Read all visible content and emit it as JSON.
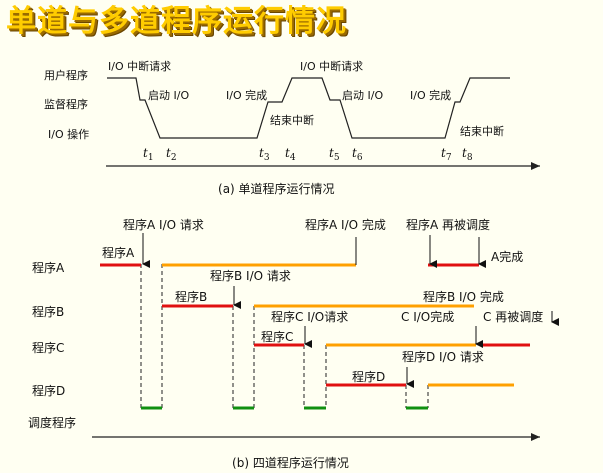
{
  "title": "单道与多道程序运行情况",
  "single": {
    "rows": [
      "用户程序",
      "监督程序",
      "I/O  操作"
    ],
    "labels": {
      "io_interrupt_1": "I/O  中断请求",
      "start_io_1": "启动  I/O",
      "io_done_1": "I/O  完成",
      "end_int_1": "结束中断",
      "io_interrupt_2": "I/O  中断请求",
      "start_io_2": "启动  I/O",
      "io_done_2": "I/O  完成",
      "end_int_2": "结束中断"
    },
    "t_labels": [
      {
        "t": "t",
        "sub": "1"
      },
      {
        "t": "t",
        "sub": "2"
      },
      {
        "t": "t",
        "sub": "3"
      },
      {
        "t": "t",
        "sub": "4"
      },
      {
        "t": "t",
        "sub": "5"
      },
      {
        "t": "t",
        "sub": "6"
      },
      {
        "t": "t",
        "sub": "7"
      },
      {
        "t": "t",
        "sub": "8"
      }
    ],
    "caption": {
      "letter": "a",
      "text": "单道程序运行情况"
    }
  },
  "multi": {
    "rows": [
      "程序A",
      "程序B",
      "程序C",
      "程序D",
      "调度程序"
    ],
    "labels": {
      "a_io_request": "程序A I/O 请求",
      "a_io_done": "程序A I/O 完成",
      "a_rescheduled": "程序A 再被调度",
      "a_done": "A完成",
      "prog_a": "程序A",
      "b_io_request": "程序B I/O 请求",
      "prog_b": "程序B",
      "b_io_done": "程序B I/O 完成",
      "c_io_request": "程序C I/O请求",
      "prog_c": "程序C",
      "c_io_done": "C I/O完成",
      "c_rescheduled": "C 再被调度",
      "d_io_request": "程序D I/O 请求",
      "prog_d": "程序D"
    },
    "caption": {
      "letter": "b",
      "text": "四道程序运行情况"
    }
  },
  "colors": {
    "run": "#e01010",
    "io": "#ffa000",
    "scheduler": "#109010",
    "line": "#222222",
    "title": "#ffcc00",
    "background": "#fffff2"
  }
}
